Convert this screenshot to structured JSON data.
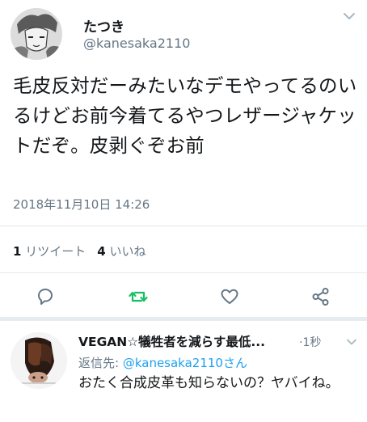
{
  "tweet": {
    "display_name": "たつき",
    "handle": "@kanesaka2110",
    "text": "毛皮反対だーみたいなデモやってるのいるけどお前今着てるやつレザージャケットだぞ。皮剥ぐぞお前",
    "timestamp": "2018年11月10日 14:26",
    "retweet_count": "1",
    "retweet_label": "リツイート",
    "like_count": "4",
    "like_label": "いいね"
  },
  "actions": {
    "reply_icon": "reply-icon",
    "retweet_icon": "retweet-icon",
    "like_icon": "heart-icon",
    "share_icon": "share-icon"
  },
  "reply": {
    "display_name": "VEGAN☆犠牲者を減らす最低...",
    "time_sep": "·",
    "time": "1秒",
    "reply_to_prefix": "返信先: ",
    "reply_to_handle": "@kanesaka2110さん",
    "text": "おたく合成皮革も知らないの？ヤバイね。"
  },
  "colors": {
    "accent": "#1da1f2",
    "retweet": "#17bf63",
    "secondary_text": "#657786",
    "primary_text": "#14171a",
    "divider": "#e1e8ed"
  }
}
